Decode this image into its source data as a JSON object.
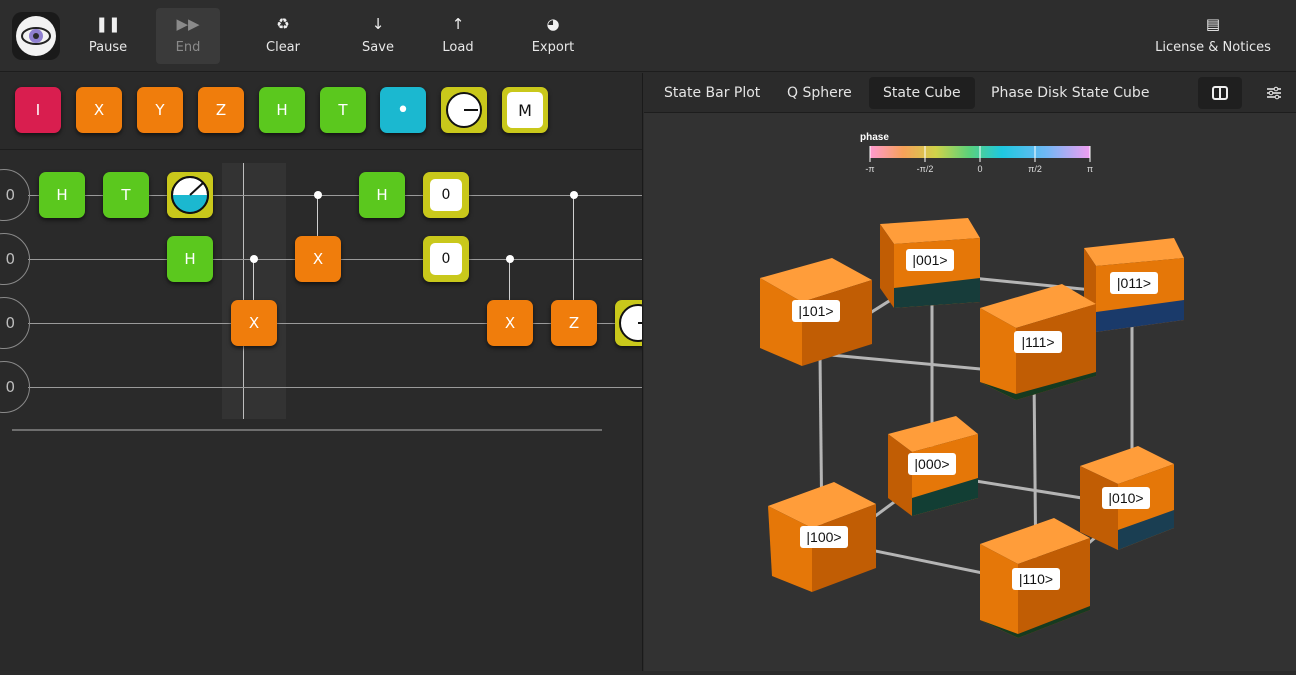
{
  "toolbar": {
    "pause": {
      "label": "Pause",
      "icon": "pause-icon"
    },
    "end": {
      "label": "End",
      "icon": "fast-forward-icon"
    },
    "clear": {
      "label": "Clear",
      "icon": "recycle-icon"
    },
    "save": {
      "label": "Save",
      "icon": "arrow-down-icon"
    },
    "load": {
      "label": "Load",
      "icon": "arrow-up-icon"
    },
    "export": {
      "label": "Export",
      "icon": "palette-icon"
    },
    "license": {
      "label": "License & Notices",
      "icon": "document-icon"
    }
  },
  "palette": [
    {
      "label": "I",
      "color": "#d91e4f"
    },
    {
      "label": "X",
      "color": "#f07d0c"
    },
    {
      "label": "Y",
      "color": "#f07d0c"
    },
    {
      "label": "Z",
      "color": "#f07d0c"
    },
    {
      "label": "H",
      "color": "#5bc81e"
    },
    {
      "label": "T",
      "color": "#5bc81e"
    },
    {
      "label": "•",
      "color": "#1bb8d0"
    },
    {
      "label": "",
      "color": "#c9c81b"
    },
    {
      "label": "M",
      "color": "#c9c81b"
    }
  ],
  "circuit": {
    "qubits": [
      "0",
      "0",
      "0",
      "0"
    ],
    "gates": {
      "q0_h1": "H",
      "q0_t": "T",
      "q0_h2": "H",
      "q0_reset": "0",
      "q1_h": "H",
      "q1_x": "X",
      "q1_reset": "0",
      "q2_x1": "X",
      "q2_x2": "X",
      "q2_z": "Z"
    }
  },
  "tabs": [
    {
      "label": "State Bar Plot"
    },
    {
      "label": "Q Sphere"
    },
    {
      "label": "State Cube",
      "active": true
    },
    {
      "label": "Phase Disk State Cube"
    }
  ],
  "viz": {
    "legend_title": "phase",
    "ticks": [
      "-π",
      "-π/2",
      "0",
      "π/2",
      "π"
    ],
    "states": [
      "|001>",
      "|011>",
      "|101>",
      "|111>",
      "|000>",
      "|010>",
      "|100>",
      "|110>"
    ]
  },
  "colors": {
    "orange": "#f07d0c",
    "green": "#5bc81e",
    "red": "#d91e4f",
    "cyan": "#1bb8d0",
    "yellow": "#c9c81b"
  }
}
